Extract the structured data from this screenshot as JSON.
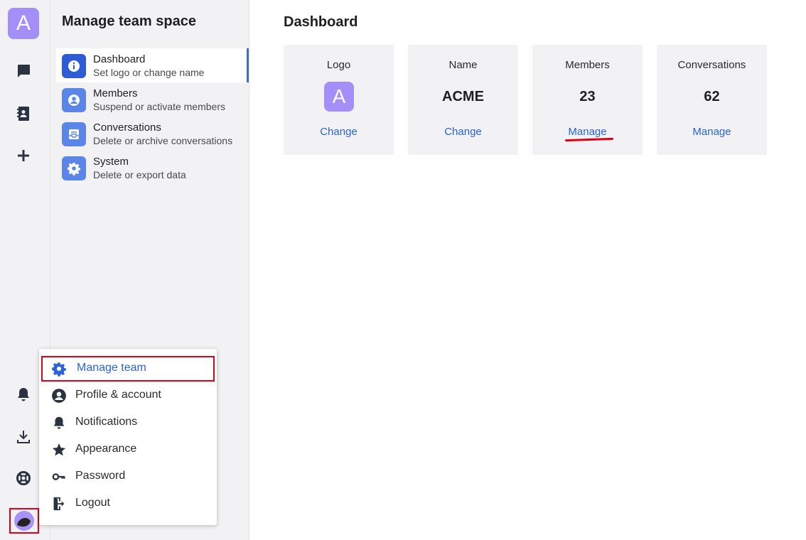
{
  "rail": {
    "team_initial": "A",
    "icons": [
      "chat-icon",
      "contacts-icon",
      "plus-icon",
      "bell-icon",
      "download-icon",
      "lifebuoy-icon"
    ]
  },
  "sidebar": {
    "title": "Manage team space",
    "items": [
      {
        "label": "Dashboard",
        "sub": "Set logo or change name",
        "icon": "info-icon",
        "active": true
      },
      {
        "label": "Members",
        "sub": "Suspend or activate members",
        "icon": "user-icon"
      },
      {
        "label": "Conversations",
        "sub": "Delete or archive conversations",
        "icon": "inbox-icon"
      },
      {
        "label": "System",
        "sub": "Delete or export data",
        "icon": "gear-icon"
      }
    ]
  },
  "main": {
    "title": "Dashboard",
    "cards": [
      {
        "label": "Logo",
        "logo_initial": "A",
        "link": "Change"
      },
      {
        "label": "Name",
        "value": "ACME",
        "link": "Change"
      },
      {
        "label": "Members",
        "value": "23",
        "link": "Manage"
      },
      {
        "label": "Conversations",
        "value": "62",
        "link": "Manage"
      }
    ]
  },
  "menu": {
    "items": [
      {
        "label": "Manage team",
        "icon": "gear-icon"
      },
      {
        "label": "Profile & account",
        "icon": "user-circle-icon"
      },
      {
        "label": "Notifications",
        "icon": "bell-icon"
      },
      {
        "label": "Appearance",
        "icon": "star-icon"
      },
      {
        "label": "Password",
        "icon": "key-icon"
      },
      {
        "label": "Logout",
        "icon": "logout-icon"
      }
    ]
  },
  "colors": {
    "accent": "#2b63d9",
    "avatar": "#a48ff8",
    "highlight": "#e0001a"
  }
}
